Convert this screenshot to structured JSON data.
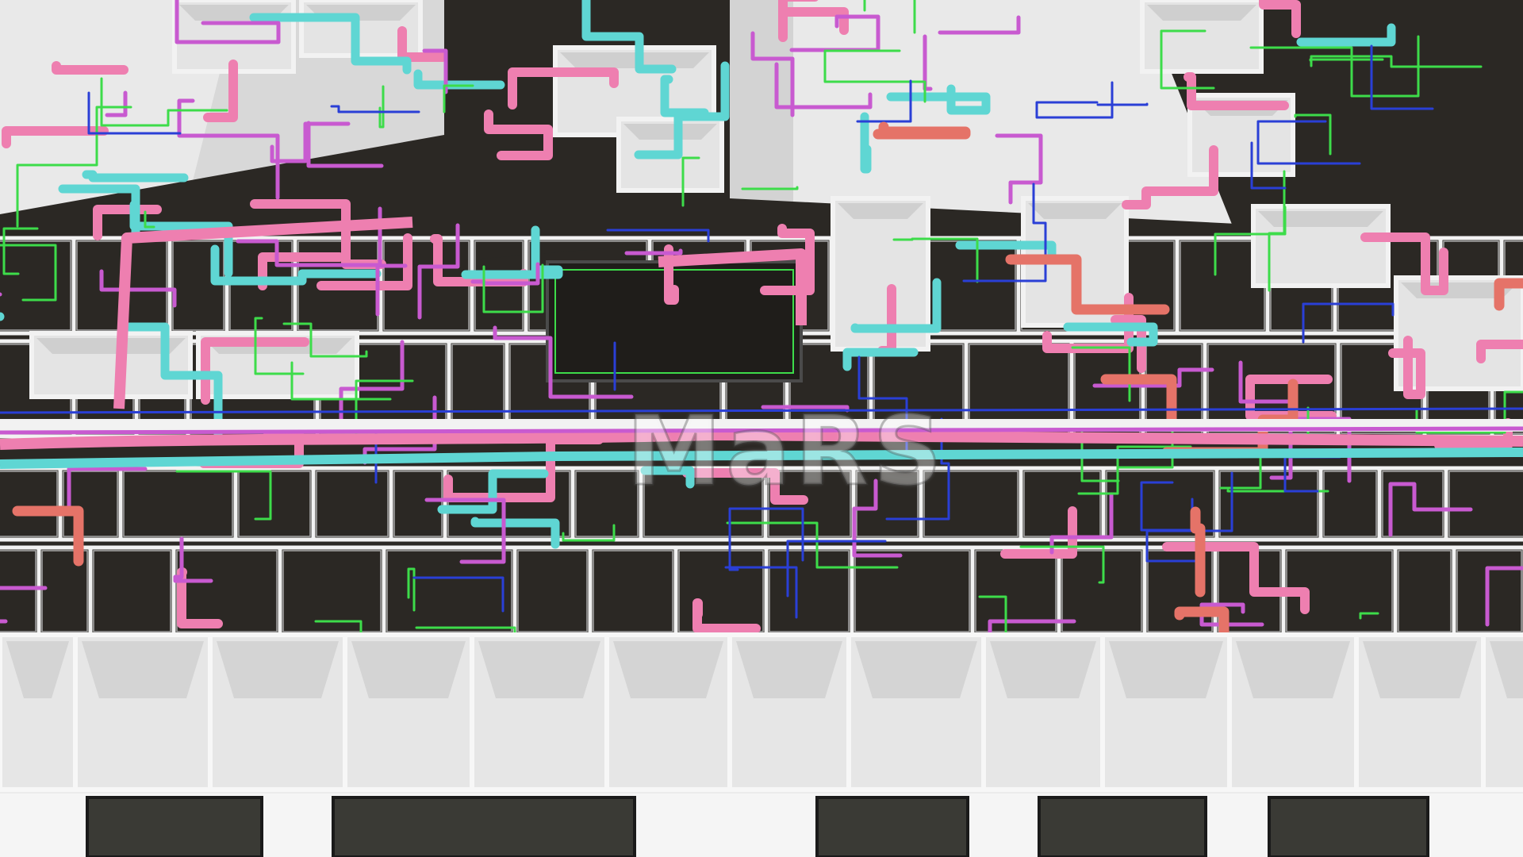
{
  "scene": {
    "subject": "bim-mep-floor-model",
    "palette": {
      "slab": "#d8d8d8",
      "slab_light": "#e9e9e9",
      "wall": "#f2f2f2",
      "wall_shadow": "#a9a9a9",
      "void_floor": "#2b2824",
      "duct_pink": "#ee7fb0",
      "duct_cyan": "#5fd6d3",
      "pipe_magenta": "#c85ad0",
      "pipe_green": "#3ddc4a",
      "pipe_blue": "#2a3fd6",
      "duct_salmon": "#e57368"
    }
  },
  "watermark": {
    "text": "MaRS"
  }
}
